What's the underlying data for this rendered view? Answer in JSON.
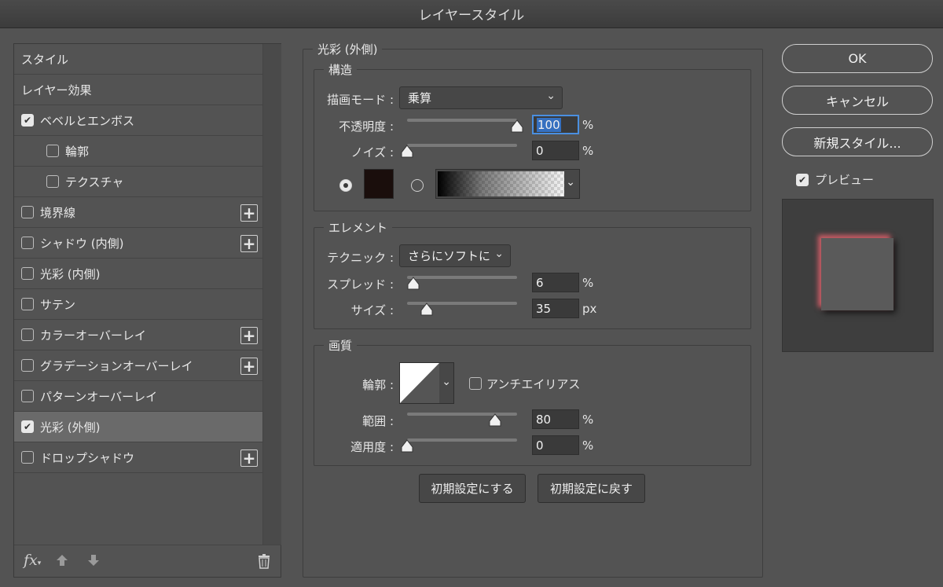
{
  "window": {
    "title": "レイヤースタイル"
  },
  "styles_panel": {
    "items": [
      {
        "label": "スタイル",
        "has_checkbox": false,
        "checked": false,
        "indent": false,
        "has_plus": false,
        "selected": false
      },
      {
        "label": "レイヤー効果",
        "has_checkbox": false,
        "checked": false,
        "indent": false,
        "has_plus": false,
        "selected": false
      },
      {
        "label": "ベベルとエンボス",
        "has_checkbox": true,
        "checked": true,
        "indent": false,
        "has_plus": false,
        "selected": false
      },
      {
        "label": "輪郭",
        "has_checkbox": true,
        "checked": false,
        "indent": true,
        "has_plus": false,
        "selected": false
      },
      {
        "label": "テクスチャ",
        "has_checkbox": true,
        "checked": false,
        "indent": true,
        "has_plus": false,
        "selected": false
      },
      {
        "label": "境界線",
        "has_checkbox": true,
        "checked": false,
        "indent": false,
        "has_plus": true,
        "selected": false
      },
      {
        "label": "シャドウ (内側)",
        "has_checkbox": true,
        "checked": false,
        "indent": false,
        "has_plus": true,
        "selected": false
      },
      {
        "label": "光彩 (内側)",
        "has_checkbox": true,
        "checked": false,
        "indent": false,
        "has_plus": false,
        "selected": false
      },
      {
        "label": "サテン",
        "has_checkbox": true,
        "checked": false,
        "indent": false,
        "has_plus": false,
        "selected": false
      },
      {
        "label": "カラーオーバーレイ",
        "has_checkbox": true,
        "checked": false,
        "indent": false,
        "has_plus": true,
        "selected": false
      },
      {
        "label": "グラデーションオーバーレイ",
        "has_checkbox": true,
        "checked": false,
        "indent": false,
        "has_plus": true,
        "selected": false
      },
      {
        "label": "パターンオーバーレイ",
        "has_checkbox": true,
        "checked": false,
        "indent": false,
        "has_plus": false,
        "selected": false
      },
      {
        "label": "光彩 (外側)",
        "has_checkbox": true,
        "checked": true,
        "indent": false,
        "has_plus": false,
        "selected": true
      },
      {
        "label": "ドロップシャドウ",
        "has_checkbox": true,
        "checked": false,
        "indent": false,
        "has_plus": true,
        "selected": false
      }
    ],
    "footer": {
      "fx_label": "fx"
    }
  },
  "outer_glow": {
    "title": "光彩 (外側)",
    "structure": {
      "legend": "構造",
      "blend_mode_label": "描画モード :",
      "blend_mode_value": "乗算",
      "opacity_label": "不透明度 :",
      "opacity_value": "100",
      "opacity_unit": "%",
      "opacity_fraction": 1.0,
      "noise_label": "ノイズ :",
      "noise_value": "0",
      "noise_unit": "%",
      "noise_fraction": 0.0,
      "color_swatch": "#1a0e0c"
    },
    "elements": {
      "legend": "エレメント",
      "technique_label": "テクニック :",
      "technique_value": "さらにソフトに",
      "spread_label": "スプレッド :",
      "spread_value": "6",
      "spread_unit": "%",
      "spread_fraction": 0.06,
      "size_label": "サイズ :",
      "size_value": "35",
      "size_unit": "px",
      "size_fraction": 0.18
    },
    "quality": {
      "legend": "画質",
      "contour_label": "輪郭 :",
      "antialias_label": "アンチエイリアス",
      "antialias_checked": false,
      "range_label": "範囲 :",
      "range_value": "80",
      "range_unit": "%",
      "range_fraction": 0.8,
      "jitter_label": "適用度 :",
      "jitter_value": "0",
      "jitter_unit": "%",
      "jitter_fraction": 0.0
    },
    "make_default_label": "初期設定にする",
    "reset_default_label": "初期設定に戻す"
  },
  "actions": {
    "ok_label": "OK",
    "cancel_label": "キャンセル",
    "new_style_label": "新規スタイル...",
    "preview_label": "プレビュー",
    "preview_checked": true
  },
  "colors": {
    "preview_glow": "#e6646e",
    "focus_blue": "#4a8fe0"
  }
}
